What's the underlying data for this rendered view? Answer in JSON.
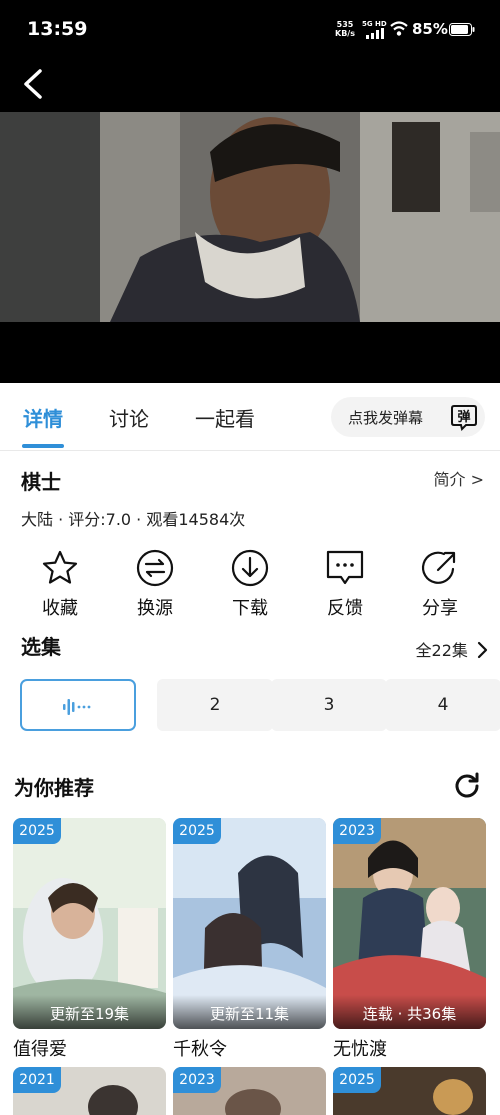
{
  "status_bar": {
    "time": "13:59",
    "net_speed": "535",
    "net_unit": "KB/s",
    "signal": "5G HD",
    "battery": "85%"
  },
  "tabs": [
    {
      "label": "详情",
      "active": true
    },
    {
      "label": "讨论",
      "active": false
    },
    {
      "label": "一起看",
      "active": false
    }
  ],
  "danmu": {
    "label": "点我发弹幕",
    "icon_text": "弹"
  },
  "show": {
    "title": "棋士",
    "intro_link": "简介 >",
    "meta": "大陆 · 评分:7.0 · 观看14584次"
  },
  "actions": [
    {
      "label": "收藏",
      "icon": "star-icon"
    },
    {
      "label": "换源",
      "icon": "switch-source-icon"
    },
    {
      "label": "下载",
      "icon": "download-icon"
    },
    {
      "label": "反馈",
      "icon": "feedback-icon"
    },
    {
      "label": "分享",
      "icon": "share-icon"
    }
  ],
  "episodes": {
    "title": "选集",
    "all_label": "全22集",
    "items": [
      "",
      "2",
      "3",
      "4"
    ],
    "playing_index": 0
  },
  "recommend": {
    "title": "为你推荐",
    "cards": [
      {
        "year": "2025",
        "update": "更新至19集",
        "name": "值得爱"
      },
      {
        "year": "2025",
        "update": "更新至11集",
        "name": "千秋令"
      },
      {
        "year": "2023",
        "update": "连载 · 共36集",
        "name": "无忧渡"
      }
    ],
    "row2_years": [
      "2021",
      "2023",
      "2025"
    ]
  },
  "colors": {
    "accent": "#2f8fd8"
  }
}
